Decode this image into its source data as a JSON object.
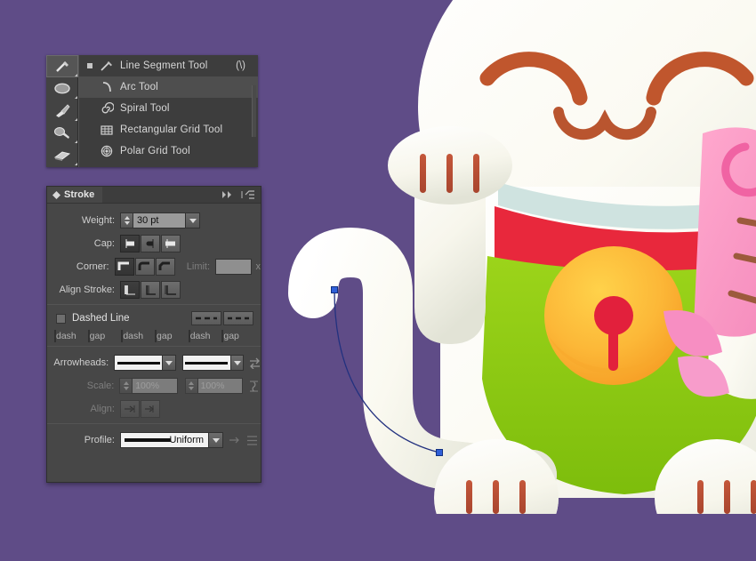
{
  "canvas": {
    "background_color": "#5f4c87",
    "artwork_name": "maneki-neko-illustration",
    "path_selection": {
      "stroke_color": "#2b3fa8",
      "anchor_color": "#2f5fd8",
      "anchor_points": [
        [
          376,
          326
        ],
        [
          494,
          509
        ]
      ]
    }
  },
  "tool_flyout": {
    "name": "line-segment-tool-flyout",
    "strip_tools": [
      {
        "name": "line-segment-tool-strip",
        "icon": "pen-line-icon",
        "selected": true
      },
      {
        "name": "ellipse-tool-strip",
        "icon": "ellipse-icon",
        "selected": false
      },
      {
        "name": "paintbrush-tool-strip",
        "icon": "paintbrush-icon",
        "selected": false
      },
      {
        "name": "pencil-tool-strip",
        "icon": "pencil-icon",
        "selected": false
      },
      {
        "name": "eraser-tool-strip",
        "icon": "eraser-icon",
        "selected": false
      }
    ],
    "items": [
      {
        "label": "Line Segment Tool",
        "shortcut": "(\\)",
        "icon": "line-segment-icon",
        "active": false,
        "bullet": true
      },
      {
        "label": "Arc Tool",
        "shortcut": "",
        "icon": "arc-icon",
        "active": true,
        "bullet": false
      },
      {
        "label": "Spiral Tool",
        "shortcut": "",
        "icon": "spiral-icon",
        "active": false,
        "bullet": false
      },
      {
        "label": "Rectangular Grid Tool",
        "shortcut": "",
        "icon": "rectangular-grid-icon",
        "active": false,
        "bullet": false
      },
      {
        "label": "Polar Grid Tool",
        "shortcut": "",
        "icon": "polar-grid-icon",
        "active": false,
        "bullet": false
      }
    ]
  },
  "stroke_panel": {
    "title": "Stroke",
    "header_icons": [
      "collapse-double-chevron-icon",
      "panel-menu-icon"
    ],
    "weight": {
      "label": "Weight:",
      "value": "30 pt"
    },
    "cap": {
      "label": "Cap:",
      "options": [
        "butt-cap",
        "round-cap",
        "projecting-cap"
      ],
      "selected_index": 0
    },
    "corner": {
      "label": "Corner:",
      "options": [
        "miter-join",
        "round-join",
        "bevel-join"
      ],
      "selected_index": 0
    },
    "limit": {
      "label": "Limit:",
      "value": "",
      "suffix": "x"
    },
    "align_stroke": {
      "label": "Align Stroke:",
      "options": [
        "align-center",
        "align-inside",
        "align-outside"
      ],
      "selected_index": 0
    },
    "dashed_line": {
      "label": "Dashed Line",
      "checked": false,
      "cap_options": [
        "dashes-preserve-exact",
        "dashes-adjust-corners"
      ]
    },
    "dash_fields": [
      {
        "name": "dash",
        "value": ""
      },
      {
        "name": "gap",
        "value": ""
      },
      {
        "name": "dash",
        "value": ""
      },
      {
        "name": "gap",
        "value": ""
      },
      {
        "name": "dash",
        "value": ""
      },
      {
        "name": "gap",
        "value": ""
      }
    ],
    "arrowheads": {
      "label": "Arrowheads:",
      "start_value": "",
      "end_value": "",
      "swap_icon": "swap-arrowheads-icon"
    },
    "scale": {
      "label": "Scale:",
      "start_value": "100%",
      "end_value": "100%",
      "link_icon": "link-scales-icon",
      "disabled": true
    },
    "align_arrow": {
      "label": "Align:",
      "options": [
        "extend-beyond-end",
        "place-at-end"
      ],
      "disabled": true
    },
    "profile": {
      "label": "Profile:",
      "value": "Uniform",
      "flip_icons": [
        "flip-across-icon",
        "flip-along-icon"
      ]
    }
  }
}
